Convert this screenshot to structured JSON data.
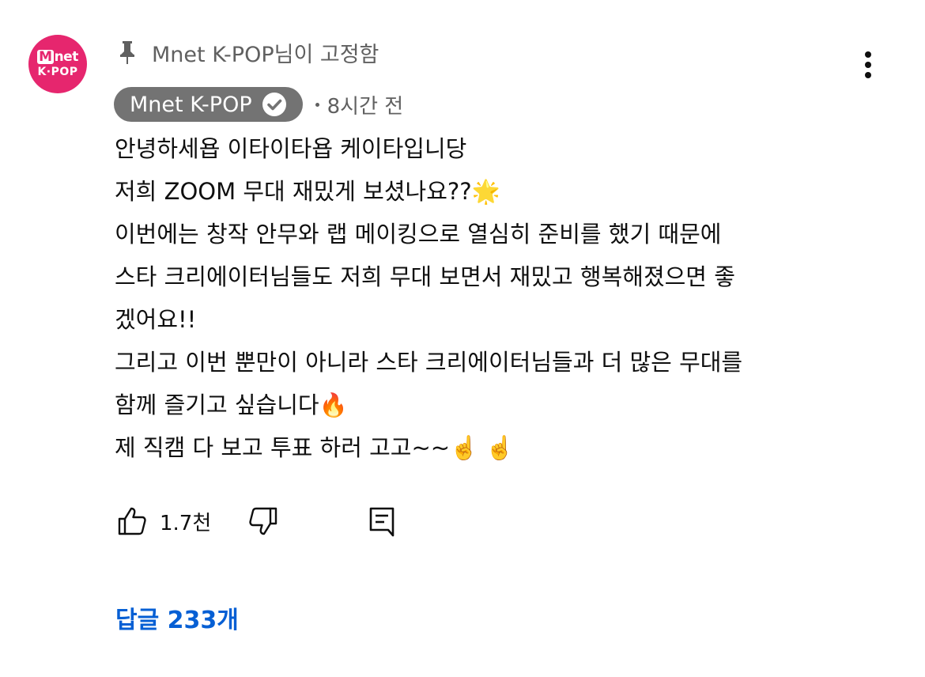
{
  "channel": {
    "avatar_logo_top": "net",
    "avatar_logo_m": "M",
    "avatar_logo_bottom": "K·POP",
    "brand_color": "#e6266e"
  },
  "pinned": {
    "icon": "pin-icon",
    "text": "Mnet K-POP님이 고정함"
  },
  "author": {
    "name": "Mnet K-POP",
    "verified_icon": "verified-check-icon",
    "timestamp": "8시간 전"
  },
  "comment": {
    "lines": [
      "안녕하세욥 이타이타욥 케이타입니당",
      "저희 ZOOM 무대 재밌게 보셨나요??🌟",
      "이번에는 창작 안무와 랩 메이킹으로 열심히 준비를 했기 때문에",
      "스타 크리에이터님들도 저희 무대 보면서 재밌고 행복해졌으면 좋",
      "겠어요!!",
      "그리고 이번 뿐만이 아니라 스타 크리에이터님들과 더 많은 무대를",
      "함께 즐기고 싶습니다🔥",
      "제 직캠 다 보고 투표 하러 고고~~☝️ ☝️"
    ]
  },
  "actions": {
    "like_icon": "thumbs-up-icon",
    "like_count": "1.7천",
    "dislike_icon": "thumbs-down-icon",
    "reply_icon": "reply-comment-icon"
  },
  "replies": {
    "label": "답글 233개",
    "color": "#065fd4"
  },
  "menu": {
    "icon": "more-vertical-icon"
  }
}
